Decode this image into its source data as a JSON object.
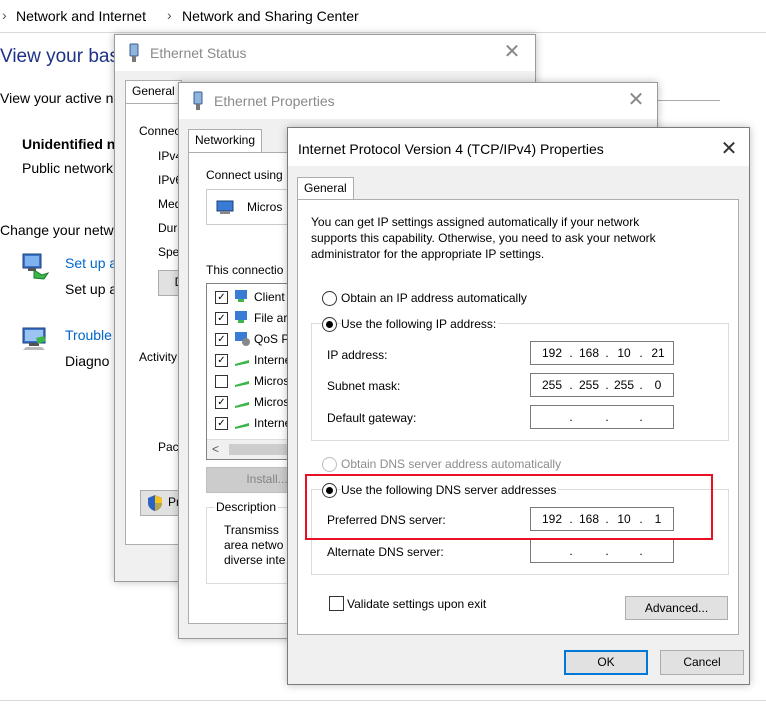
{
  "breadcrumb": {
    "sep": "›",
    "item1": "Network and Internet",
    "item2": "Network and Sharing Center"
  },
  "background": {
    "heading": "View your bas",
    "subheading": "View your active n",
    "network_name": "Unidentified n",
    "network_type": "Public network",
    "change_label": "Change your netw",
    "setup_link": "Set up a",
    "setup_desc": "Set up a",
    "trouble_link": "Trouble",
    "trouble_desc": "Diagno"
  },
  "ethernet_status": {
    "title": "Ethernet Status",
    "tab": "General",
    "connection_label": "Connec",
    "rows": [
      "IPv4",
      "IPv6",
      "Med",
      "Dura",
      "Spe"
    ],
    "details_btn": "D",
    "activity_label": "Activity",
    "packets_label": "Pack",
    "properties_btn": "Pr"
  },
  "ethernet_properties": {
    "title": "Ethernet Properties",
    "tab": "Networking",
    "connect_using": "Connect using",
    "adapter": "Micros",
    "items_label": "This connectio",
    "items": [
      {
        "label": "Client",
        "checked": true
      },
      {
        "label": "File ar",
        "checked": true
      },
      {
        "label": "QoS P",
        "checked": true
      },
      {
        "label": "Interne",
        "checked": true
      },
      {
        "label": "Micros",
        "checked": false
      },
      {
        "label": "Micros",
        "checked": true
      },
      {
        "label": "Interne",
        "checked": true
      }
    ],
    "scroll_left": "<",
    "install_btn": "Install...",
    "description_label": "Description",
    "description_lines": [
      "Transmiss",
      "area netwo",
      "diverse inte"
    ]
  },
  "ipv4": {
    "title": "Internet Protocol Version 4 (TCP/IPv4) Properties",
    "tab": "General",
    "intro": [
      "You can get IP settings assigned automatically if your network",
      "supports this capability. Otherwise, you need to ask your network",
      "administrator for the appropriate IP settings."
    ],
    "obtain_ip_auto": "Obtain an IP address automatically",
    "use_ip": "Use the following IP address:",
    "ip_label": "IP address:",
    "ip_value": [
      "192",
      "168",
      "10",
      "21"
    ],
    "subnet_label": "Subnet mask:",
    "subnet_value": [
      "255",
      "255",
      "255",
      "0"
    ],
    "gateway_label": "Default gateway:",
    "gateway_value": [
      "",
      "",
      "",
      ""
    ],
    "obtain_dns_auto": "Obtain DNS server address automatically",
    "use_dns": "Use the following DNS server addresses",
    "pref_dns_label": "Preferred DNS server:",
    "pref_dns_value": [
      "192",
      "168",
      "10",
      "1"
    ],
    "alt_dns_label": "Alternate DNS server:",
    "alt_dns_value": [
      "",
      "",
      "",
      ""
    ],
    "validate_label": "Validate settings upon exit",
    "advanced_btn": "Advanced...",
    "ok_btn": "OK",
    "cancel_btn": "Cancel",
    "dot": "."
  },
  "colors": {
    "link": "#0066cc",
    "highlight": "#e81123",
    "accent": "#0078d7"
  }
}
